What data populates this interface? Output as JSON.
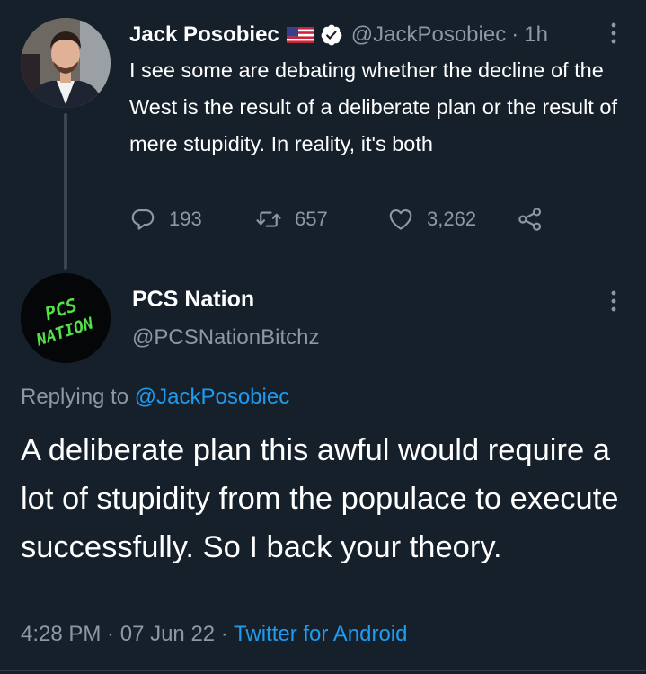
{
  "theme": {
    "background": "#16202b",
    "text": "#ffffff",
    "muted": "#8b98a5",
    "accent": "#1d9bf0",
    "thread_line": "#3b4551"
  },
  "parent_tweet": {
    "author_name": "Jack Posobiec",
    "flag_icon": "us-flag-icon",
    "verified_icon": "verified-badge-icon",
    "handle": "@JackPosobiec",
    "separator": "·",
    "time": "1h",
    "text": "I see some are debating whether the decline of the West is the result of a deliberate plan or the result of mere stupidity. In reality, it's both",
    "replies": "193",
    "retweets": "657",
    "likes": "3,262"
  },
  "reply_tweet": {
    "author_name": "PCS Nation",
    "avatar_text_line1": "PCS",
    "avatar_text_line2": "NATION",
    "handle": "@PCSNationBitchz",
    "replying_prefix": "Replying to ",
    "replying_to": "@JackPosobiec",
    "text": "A deliberate plan this awful would require a lot of stupidity from the populace to execute successfully. So I back your theory.",
    "time": "4:28 PM",
    "date": "07 Jun 22",
    "separator": " · ",
    "source": "Twitter for Android"
  }
}
